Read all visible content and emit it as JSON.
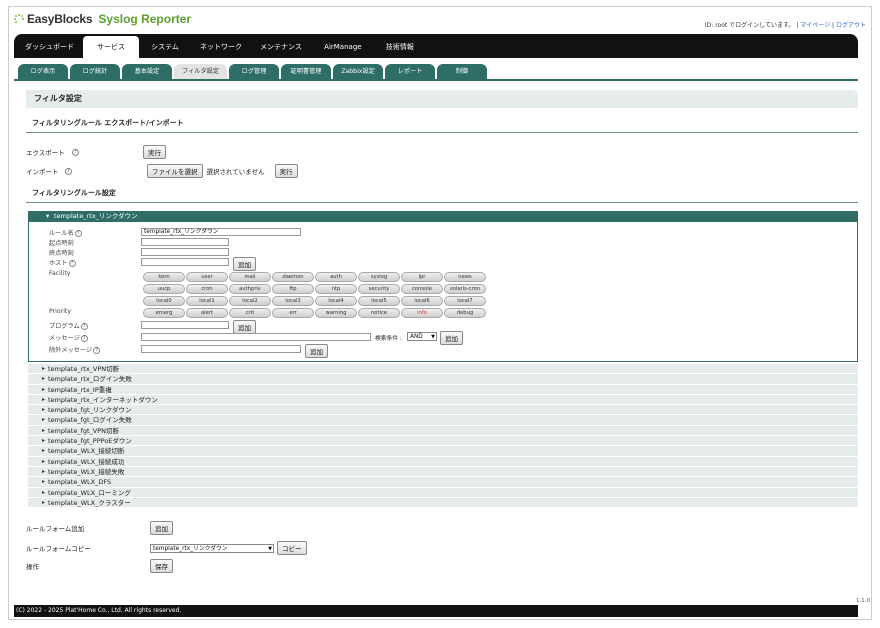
{
  "header": {
    "logo_main": "EasyBlocks",
    "logo_product": "Syslog Reporter",
    "login_text": "ID: root でログインしています。",
    "mypage_link": "マイページ",
    "logout_link": "ログアウト"
  },
  "main_nav": [
    {
      "label": "ダッシュボード",
      "active": false
    },
    {
      "label": "サービス",
      "active": true
    },
    {
      "label": "システム",
      "active": false
    },
    {
      "label": "ネットワーク",
      "active": false
    },
    {
      "label": "メンテナンス",
      "active": false
    },
    {
      "label": "AirManage",
      "active": false
    },
    {
      "label": "技術情報",
      "active": false
    }
  ],
  "sub_tabs": [
    {
      "label": "ログ表示",
      "active": false
    },
    {
      "label": "ログ統計",
      "active": false
    },
    {
      "label": "基本設定",
      "active": false
    },
    {
      "label": "フィルタ設定",
      "active": true
    },
    {
      "label": "ログ管理",
      "active": false
    },
    {
      "label": "証明書管理",
      "active": false
    },
    {
      "label": "Zabbix設定",
      "active": false
    },
    {
      "label": "レポート",
      "active": false
    },
    {
      "label": "制御",
      "active": false
    }
  ],
  "page_title": "フィルタ設定",
  "export_import": {
    "section_title": "フィルタリングルール エクスポート/インポート",
    "export_label": "エクスポート",
    "export_button": "実行",
    "import_label": "インポート",
    "file_button": "ファイルを選択",
    "file_status": "選択されていません",
    "import_button": "実行",
    "help": "?"
  },
  "rule_settings": {
    "section_title": "フィルタリングルール設定",
    "open_rule": {
      "header": "template_rtx_リンクダウン",
      "rule_name_label": "ルール名",
      "rule_name_value": "template_rtx_リンクダウン",
      "start_time_label": "起点時刻",
      "end_time_label": "終点時刻",
      "host_label": "ホスト",
      "host_add": "追加",
      "facility_label": "Facility",
      "facility": [
        "kern",
        "user",
        "mail",
        "daemon",
        "auth",
        "syslog",
        "lpr",
        "news",
        "uucp",
        "cron",
        "authpriv",
        "ftp",
        "ntp",
        "security",
        "console",
        "solaris-cron",
        "local0",
        "local1",
        "local2",
        "local3",
        "local4",
        "local5",
        "local6",
        "local7"
      ],
      "priority_label": "Priority",
      "priority": [
        "emerg",
        "alert",
        "crit",
        "err",
        "warning",
        "notice",
        "info",
        "debug"
      ],
      "priority_highlight": "info",
      "program_label": "プログラム",
      "program_add": "追加",
      "message_label": "メッセージ",
      "search_cond_label": "検索条件 :",
      "search_cond_value": "AND",
      "message_add": "追加",
      "exclude_label": "除外メッセージ",
      "exclude_add": "追加"
    },
    "templates": [
      "template_rtx_VPN切断",
      "template_rtx_ログイン失敗",
      "template_rtx_IP重複",
      "template_rtx_インターネットダウン",
      "template_fgt_リンクダウン",
      "template_fgt_ログイン失敗",
      "template_fgt_VPN切断",
      "template_fgt_PPPoEダウン",
      "template_WLX_接続切断",
      "template_WLX_接続成功",
      "template_WLX_接続失敗",
      "template_WLX_DFS",
      "template_WLX_ローミング",
      "template_WLX_クラスター"
    ]
  },
  "bottom": {
    "add_form_label": "ルールフォーム追加",
    "add_button": "追加",
    "copy_form_label": "ルールフォームコピー",
    "copy_select": "template_rtx_リンクダウン",
    "copy_button": "コピー",
    "op_label": "操作",
    "save_button": "保存"
  },
  "footer": {
    "copyright": "(C) 2022 - 2025 Plat'Home Co., Ltd. All rights reserved.",
    "version": "1.1.0"
  }
}
